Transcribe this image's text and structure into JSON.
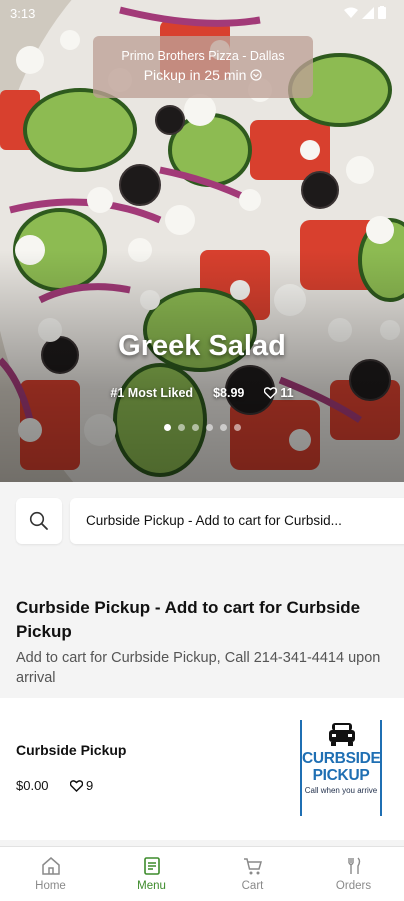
{
  "status_bar": {
    "time": "3:13"
  },
  "hero": {
    "restaurant": "Primo Brothers Pizza - Dallas",
    "pickup_text": "Pickup in 25 min",
    "dish_name": "Greek Salad",
    "rank": "#1 Most Liked",
    "price": "$8.99",
    "likes": "11",
    "carousel_count": 6,
    "carousel_active": 0
  },
  "category": {
    "label": "Curbside Pickup - Add to cart for Curbsid..."
  },
  "section": {
    "title": "Curbside Pickup - Add to cart for Curbside Pickup",
    "description": "Add to cart for Curbside Pickup, Call 214-341-4414 upon arrival"
  },
  "item": {
    "name": "Curbside Pickup",
    "price": "$0.00",
    "likes": "9",
    "image_text": {
      "line1": "CURBSIDE",
      "line2": "PICKUP",
      "line3": "Call when you arrive"
    }
  },
  "nav": [
    {
      "label": "Home",
      "icon": "home-icon",
      "active": false
    },
    {
      "label": "Menu",
      "icon": "menu-icon",
      "active": true
    },
    {
      "label": "Cart",
      "icon": "cart-icon",
      "active": false
    },
    {
      "label": "Orders",
      "icon": "orders-icon",
      "active": false
    }
  ],
  "colors": {
    "accent": "#3d8b2b",
    "curbside_blue": "#1f6fb3"
  }
}
